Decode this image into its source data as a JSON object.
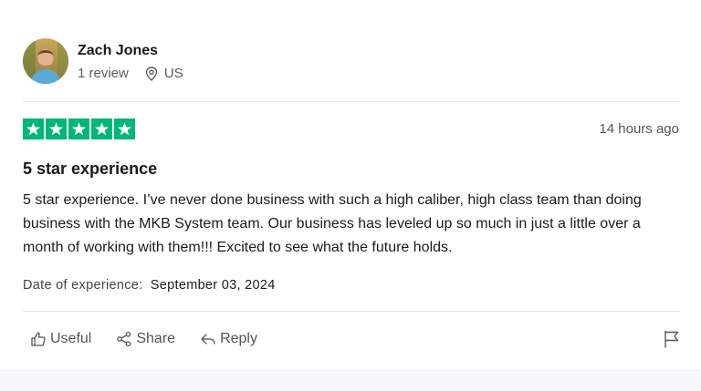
{
  "reviewer": {
    "name": "Zach Jones",
    "review_count": "1 review",
    "country": "US"
  },
  "review": {
    "rating": 5,
    "rating_max": 5,
    "timestamp": "14 hours ago",
    "title": "5 star experience",
    "body": "5 star experience. I’ve never done business with such a high caliber, high class team than doing business with the MKB System team. Our business has leveled up so much in just a little over a month of working with them!!! Excited to see what the future holds.",
    "experience_label": "Date of experience:",
    "experience_date": "September 03, 2024"
  },
  "actions": {
    "useful_label": "Useful",
    "share_label": "Share",
    "reply_label": "Reply"
  },
  "icons": {
    "location": "map-pin-icon",
    "useful": "thumbs-up-icon",
    "share": "share-icon",
    "reply": "reply-icon",
    "report": "flag-icon"
  },
  "colors": {
    "star_green": "#00b67a",
    "text_dark": "#1c1c1c",
    "text_muted": "#5c5c5c"
  }
}
